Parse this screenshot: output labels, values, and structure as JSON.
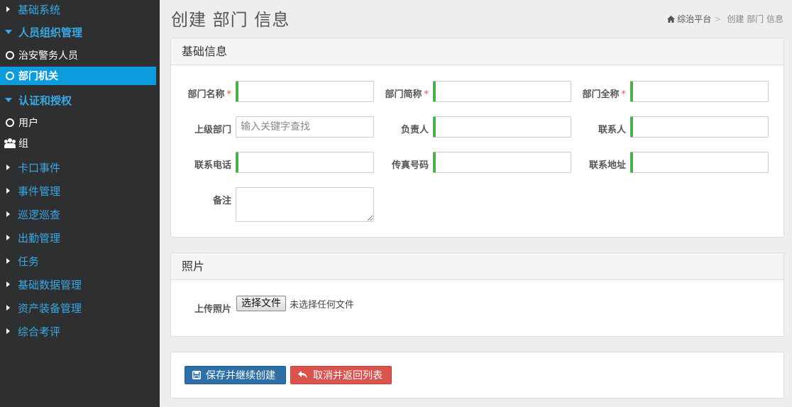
{
  "sidebar": {
    "items": [
      {
        "label": "基础系统"
      },
      {
        "label": "人员组织管理"
      },
      {
        "label": "治安警务人员"
      },
      {
        "label": "部门机关"
      },
      {
        "label": "认证和授权"
      },
      {
        "label": "用户"
      },
      {
        "label": "组"
      },
      {
        "label": "卡口事件"
      },
      {
        "label": "事件管理"
      },
      {
        "label": "巡逻巡查"
      },
      {
        "label": "出勤管理"
      },
      {
        "label": "任务"
      },
      {
        "label": "基础数据管理"
      },
      {
        "label": "资产装备管理"
      },
      {
        "label": "综合考评"
      }
    ]
  },
  "header": {
    "title": "创建 部门 信息",
    "breadcrumb": {
      "home": "综治平台",
      "separator": ">",
      "current": "创建 部门 信息"
    }
  },
  "basic_panel": {
    "title": "基础信息",
    "required_mark": "*",
    "fields": {
      "dept_name": {
        "label": "部门名称",
        "value": ""
      },
      "dept_short": {
        "label": "部门简称",
        "value": ""
      },
      "dept_full": {
        "label": "部门全称",
        "value": ""
      },
      "parent_dept": {
        "label": "上级部门",
        "placeholder": "输入关键字查找"
      },
      "manager": {
        "label": "负责人",
        "value": ""
      },
      "contact": {
        "label": "联系人",
        "value": ""
      },
      "phone": {
        "label": "联系电话",
        "value": ""
      },
      "fax": {
        "label": "传真号码",
        "value": ""
      },
      "address": {
        "label": "联系地址",
        "value": ""
      },
      "remark": {
        "label": "备注",
        "value": ""
      }
    }
  },
  "photo_panel": {
    "title": "照片",
    "upload_label": "上传照片",
    "choose_button": "选择文件",
    "file_status": "未选择任何文件"
  },
  "actions": {
    "save_label": "保存并继续创建",
    "cancel_label": "取消并返回列表"
  },
  "colors": {
    "sidebar_bg": "#2e2f31",
    "sidebar_accent": "#3aa8e4",
    "active_bg": "#0c9bdc",
    "required_border": "#4cae4c",
    "save_btn": "#2d6fa6",
    "cancel_btn": "#d9534f"
  }
}
